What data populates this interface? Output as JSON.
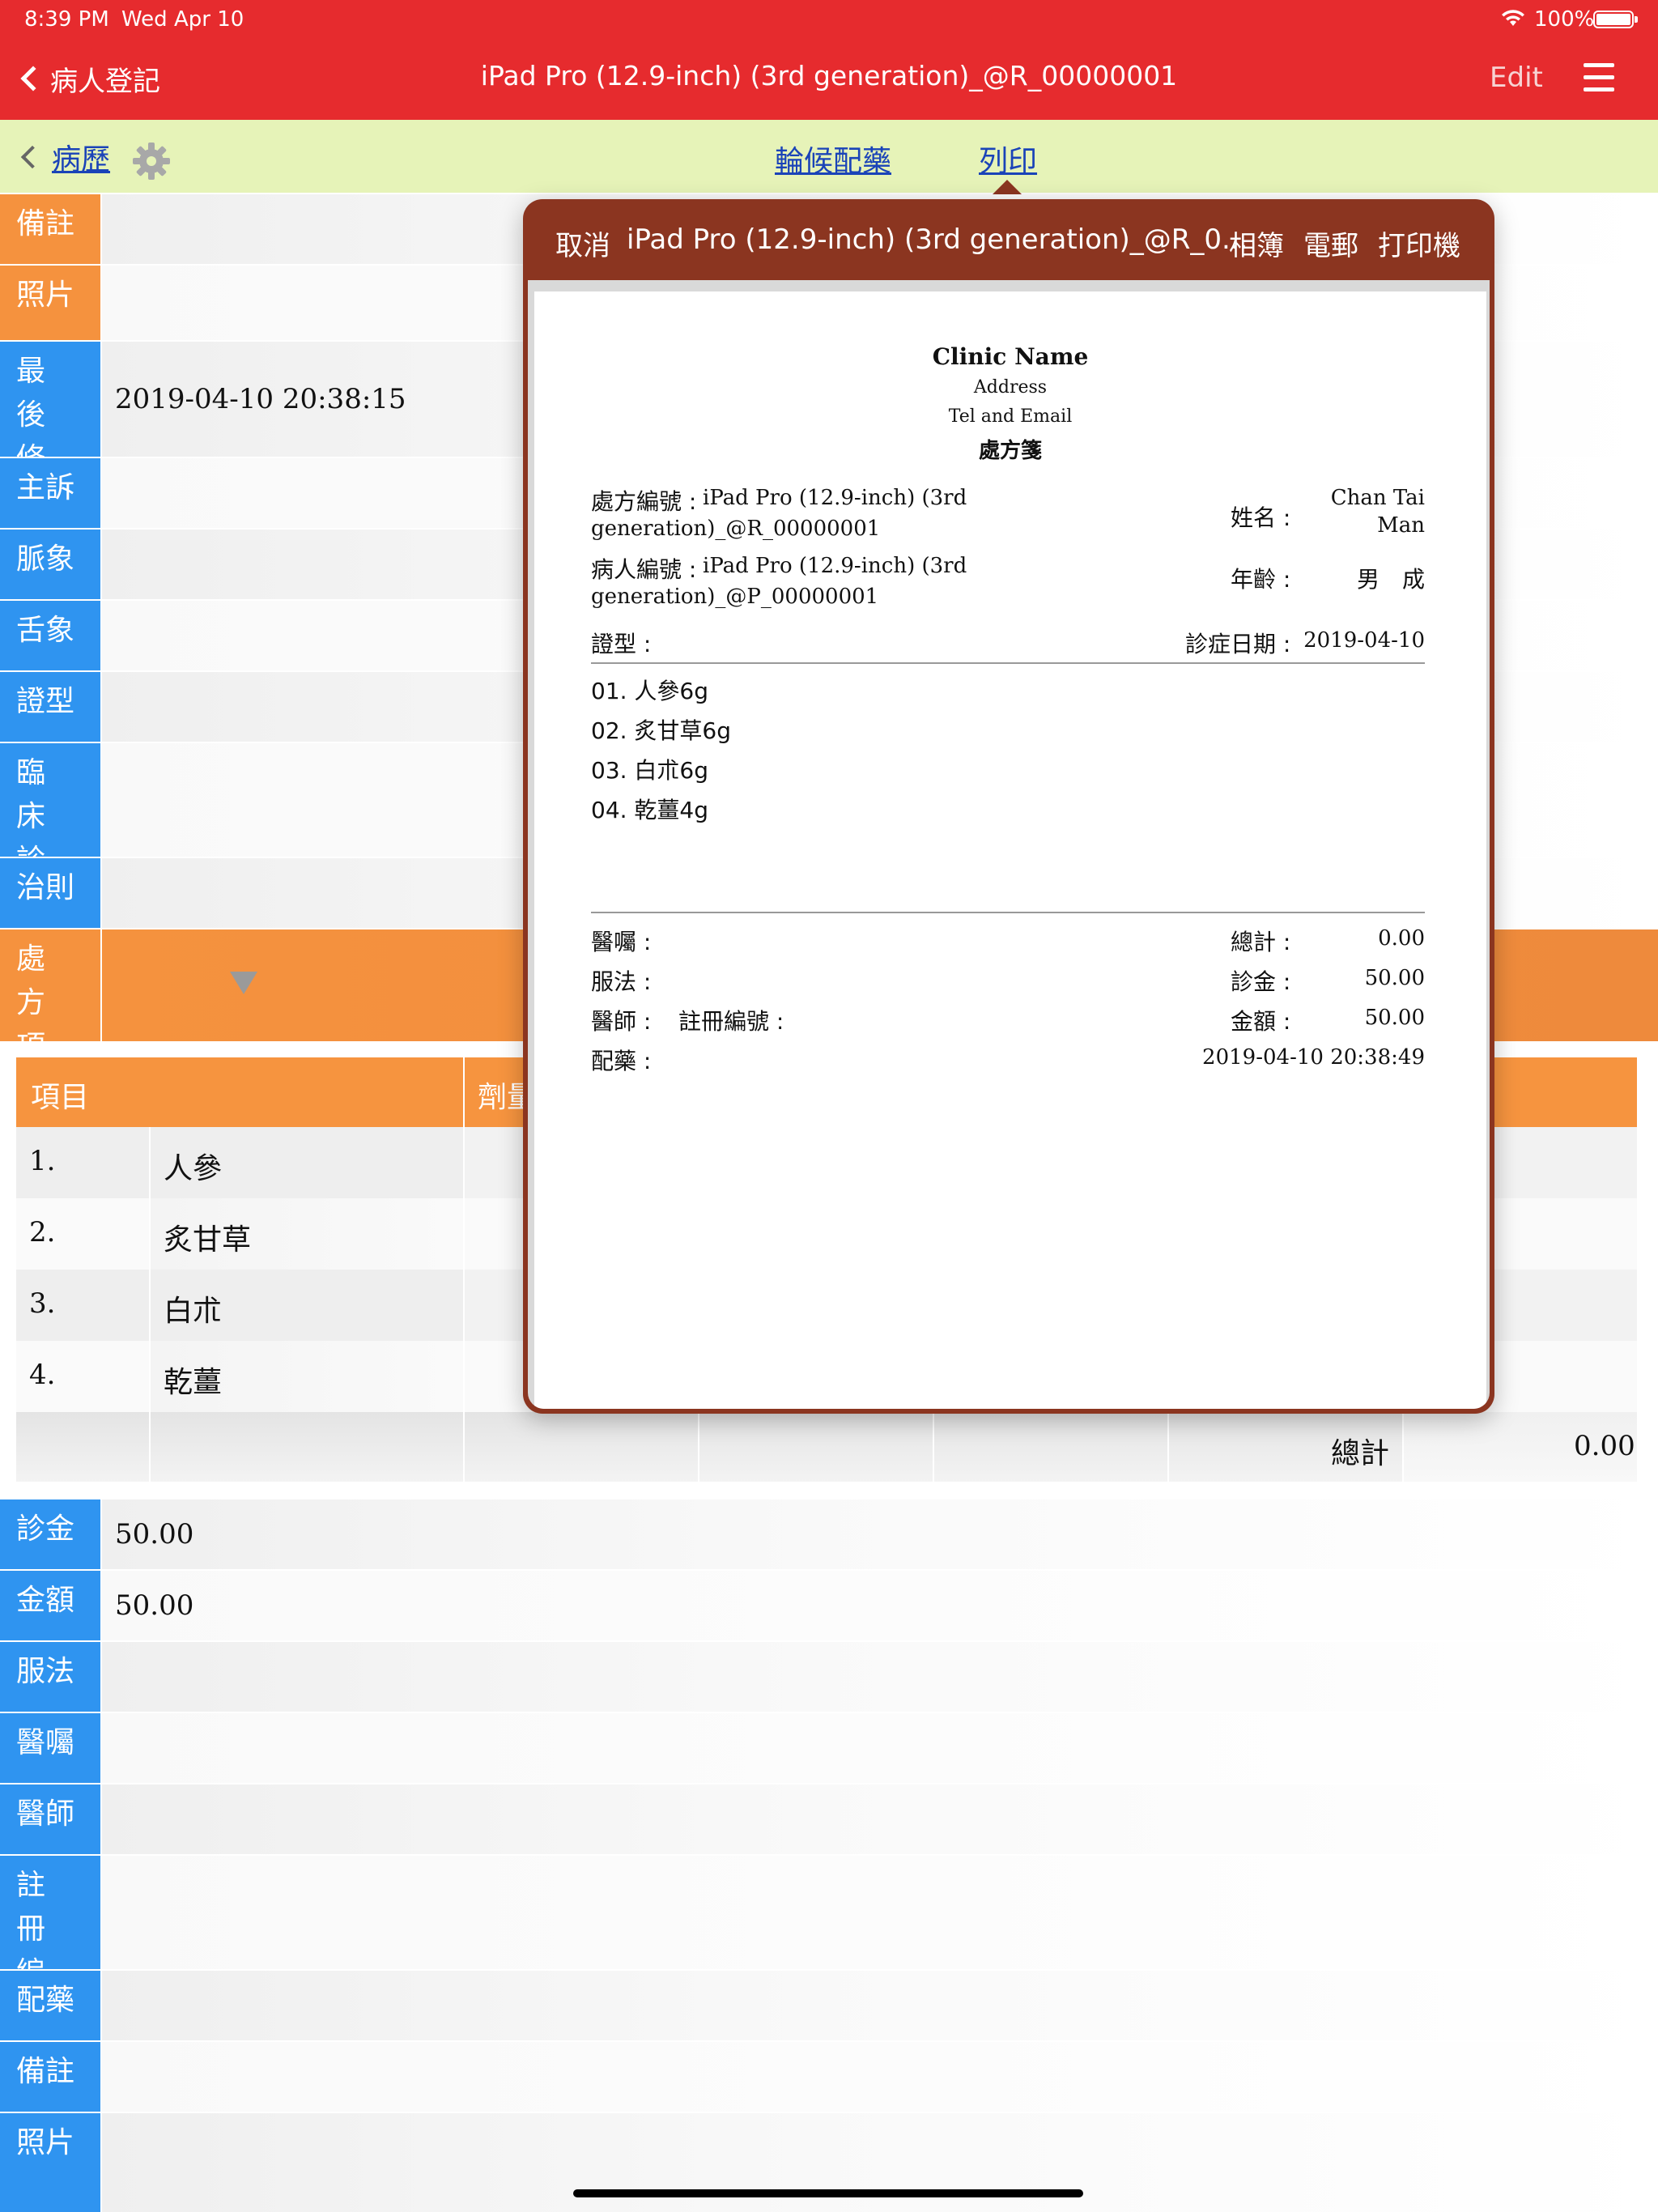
{
  "status_bar": {
    "time": "8:39 PM",
    "date": "Wed Apr 10",
    "battery": "100%",
    "battery_level": 1.0,
    "icons": [
      "wifi-icon",
      "battery-icon"
    ]
  },
  "nav": {
    "back_label": "病人登記",
    "title": "iPad Pro (12.9-inch) (3rd generation)_@R_00000001",
    "edit_label": "Edit",
    "menu_icon": "hamburger-menu-icon"
  },
  "subbar": {
    "back_label": "病歷",
    "gear_icon": "gear-icon",
    "tab_queue": "輪候配藥",
    "tab_print": "列印"
  },
  "form": {
    "remarks_top": {
      "label": "備註",
      "value": ""
    },
    "photo_top": {
      "label": "照片",
      "value": ""
    },
    "last_modified": {
      "label": "最後修改",
      "value": "2019-04-10 20:38:15"
    },
    "chief_complaint": {
      "label": "主訴",
      "value": ""
    },
    "pulse": {
      "label": "脈象",
      "value": ""
    },
    "tongue": {
      "label": "舌象",
      "value": ""
    },
    "syndrome": {
      "label": "證型",
      "value": ""
    },
    "diagnosis": {
      "label": "臨床診斷",
      "value": ""
    },
    "treatment": {
      "label": "治則",
      "value": ""
    },
    "rx_items": {
      "label": "處方項目"
    },
    "consult_fee": {
      "label": "診金",
      "value": "50.00"
    },
    "amount": {
      "label": "金額",
      "value": "50.00"
    },
    "usage": {
      "label": "服法",
      "value": ""
    },
    "advice": {
      "label": "醫囑",
      "value": ""
    },
    "doctor": {
      "label": "醫師",
      "value": ""
    },
    "reg_no": {
      "label": "註冊編號",
      "value": ""
    },
    "dispense": {
      "label": "配藥",
      "value": ""
    },
    "remarks_bottom": {
      "label": "備註",
      "value": ""
    },
    "photo_bottom": {
      "label": "照片",
      "value": ""
    }
  },
  "item_table": {
    "headers": [
      "項目",
      "劑量"
    ],
    "rows": [
      {
        "num": "1.",
        "name": "人參"
      },
      {
        "num": "2.",
        "name": "炙甘草"
      },
      {
        "num": "3.",
        "name": "白朮"
      },
      {
        "num": "4.",
        "name": "乾薑"
      }
    ],
    "total_label": "總計",
    "total_value": "0.00"
  },
  "popover": {
    "cancel": "取消",
    "title": "iPad Pro (12.9-inch) (3rd generation)_@R_0...",
    "album": "相簿",
    "email": "電郵",
    "printer": "打印機"
  },
  "prescription": {
    "clinic_name": "Clinic Name",
    "address": "Address",
    "tel_email": "Tel and Email",
    "heading": "處方箋",
    "rx_no_label": "處方編號 :",
    "rx_no_value_1": "iPad Pro (12.9-inch) (3rd",
    "rx_no_value_2": "generation)_@R_00000001",
    "patient_no_label": "病人編號 :",
    "patient_no_value_1": "iPad Pro (12.9-inch) (3rd",
    "patient_no_value_2": "generation)_@P_00000001",
    "syndrome_label": "證型 :",
    "name_label": "姓名 :",
    "name_value_1": "Chan Tai",
    "name_value_2": "Man",
    "age_label": "年齡 :",
    "gender_value": "男　成",
    "visit_date_label": "診症日期 :",
    "visit_date_value": "2019-04-10",
    "herbs": [
      "01. 人參6g",
      "02. 炙甘草6g",
      "03. 白朮6g",
      "04. 乾薑4g"
    ],
    "advice_label": "醫囑 :",
    "usage_label": "服法 :",
    "doctor_label": "醫師 :",
    "reg_label": "註冊編號 :",
    "dispense_label": "配藥 :",
    "total_label": "總計 :",
    "total_value": "0.00",
    "fee_label": "診金 :",
    "fee_value": "50.00",
    "amount_label": "金額 :",
    "amount_value": "50.00",
    "printed_at": "2019-04-10 20:38:49"
  }
}
